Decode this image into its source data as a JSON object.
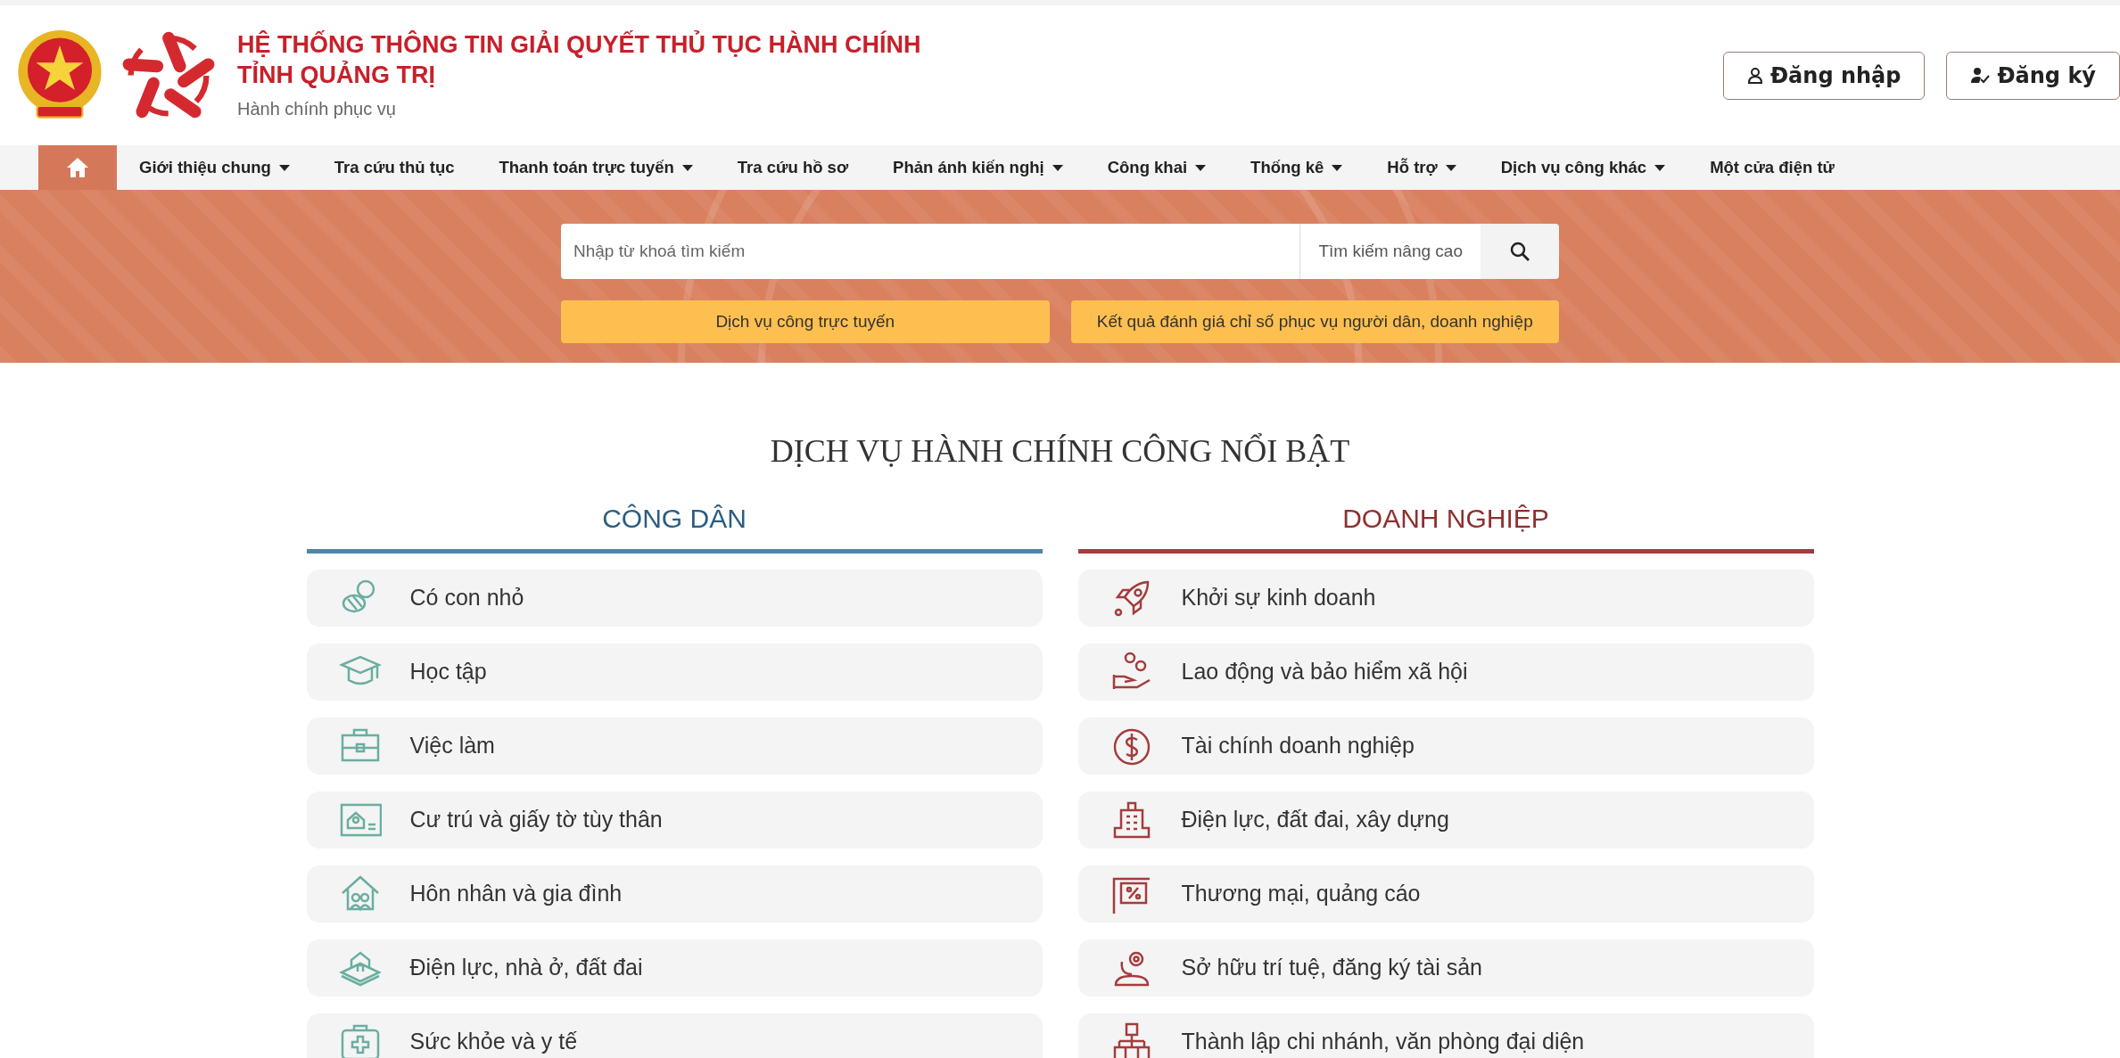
{
  "header": {
    "title_line_1": "HỆ THỐNG THÔNG TIN GIẢI QUYẾT THỦ TỤC HÀNH CHÍNH",
    "title_line_2": "TỈNH QUẢNG TRỊ",
    "subtitle": "Hành chính phục vụ",
    "account_buttons": [
      {
        "kind": "login",
        "label": "Đăng nhập"
      },
      {
        "kind": "register",
        "label": "Đăng ký"
      }
    ]
  },
  "nav": {
    "home": {
      "selected": true
    },
    "items": [
      {
        "label": "Giới thiệu chung",
        "dropdown": true,
        "selected": false
      },
      {
        "label": "Tra cứu thủ tục",
        "dropdown": false,
        "selected": false
      },
      {
        "label": "Thanh toán trực tuyến",
        "dropdown": true,
        "selected": false
      },
      {
        "label": "Tra cứu hồ sơ",
        "dropdown": false,
        "selected": false
      },
      {
        "label": "Phản ánh kiến nghị",
        "dropdown": true,
        "selected": false
      },
      {
        "label": "Công khai",
        "dropdown": true,
        "selected": false
      },
      {
        "label": "Thống kê",
        "dropdown": true,
        "selected": false
      },
      {
        "label": "Hỗ trợ",
        "dropdown": true,
        "selected": false
      },
      {
        "label": "Dịch vụ công khác",
        "dropdown": true,
        "selected": false
      },
      {
        "label": "Một cửa điện tử",
        "dropdown": false,
        "selected": false
      }
    ]
  },
  "search": {
    "placeholder": "Nhập từ khoá tìm kiếm",
    "advanced_label": "Tìm kiếm nâng cao",
    "quick_buttons": [
      "Dịch vụ công trực tuyến",
      "Kết quả đánh giá chỉ số phục vụ người dân, doanh nghiệp"
    ]
  },
  "featured": {
    "title": "DỊCH VỤ HÀNH CHÍNH CÔNG NỔI BẬT",
    "groups": [
      {
        "kind": "citizen",
        "heading": "CÔNG DÂN",
        "items": [
          "Có con nhỏ",
          "Học tập",
          "Việc làm",
          "Cư trú và giấy tờ tùy thân",
          "Hôn nhân và gia đình",
          "Điện lực, nhà ở, đất đai",
          "Sức khỏe và y tế"
        ]
      },
      {
        "kind": "business",
        "heading": "DOANH NGHIỆP",
        "items": [
          "Khởi sự kinh doanh",
          "Lao động và bảo hiểm xã hội",
          "Tài chính doanh nghiệp",
          "Điện lực, đất đai, xây dựng",
          "Thương mại, quảng cáo",
          "Sở hữu trí tuệ, đăng ký tài sản",
          "Thành lập chi nhánh, văn phòng đại diện"
        ]
      }
    ]
  }
}
